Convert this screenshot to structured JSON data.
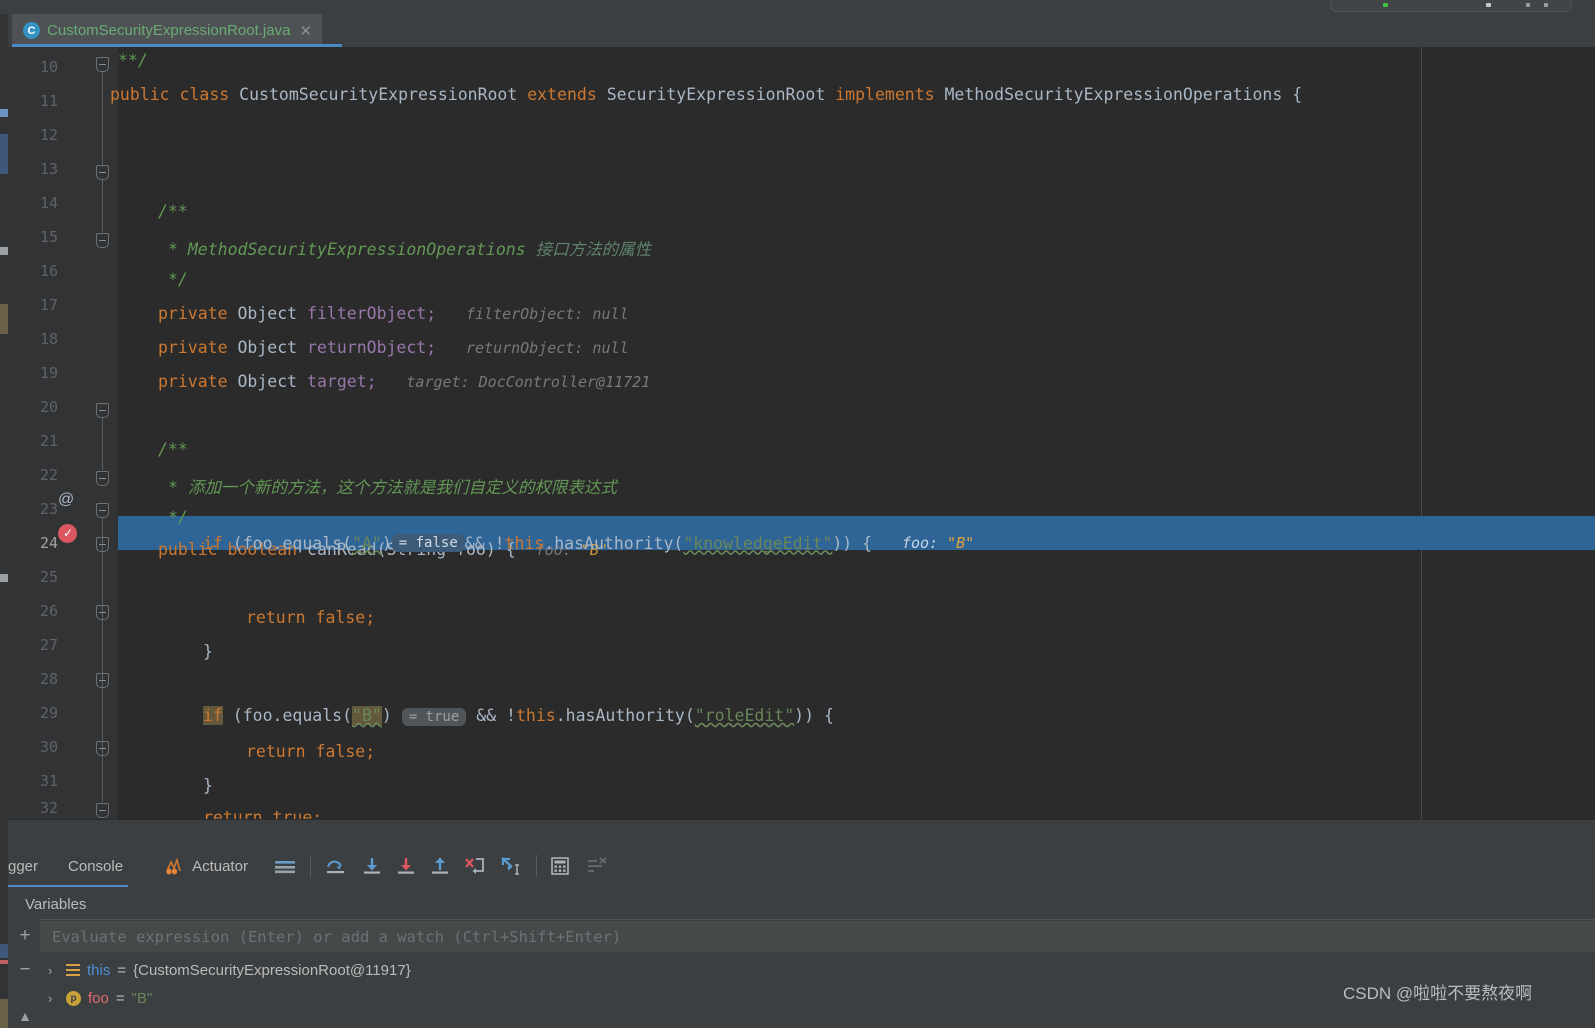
{
  "window": {
    "tab": {
      "icon": "java-class-icon",
      "label": "CustomSecurityExpressionRoot.java",
      "close": "✕"
    }
  },
  "editor": {
    "margin_guide": true,
    "lines": [
      {
        "num": "10",
        "fold": true,
        "gutter": "",
        "selected": false
      },
      {
        "num": "11",
        "fold": false,
        "gutter": "",
        "selected": false
      },
      {
        "num": "12",
        "fold": false,
        "gutter": "",
        "selected": false
      },
      {
        "num": "13",
        "fold": true,
        "gutter": "",
        "selected": false
      },
      {
        "num": "14",
        "fold": false,
        "gutter": "",
        "selected": false
      },
      {
        "num": "15",
        "fold": true,
        "gutter": "",
        "selected": false
      },
      {
        "num": "16",
        "fold": false,
        "gutter": "",
        "selected": false
      },
      {
        "num": "17",
        "fold": false,
        "gutter": "",
        "selected": false
      },
      {
        "num": "18",
        "fold": false,
        "gutter": "",
        "selected": false
      },
      {
        "num": "19",
        "fold": false,
        "gutter": "",
        "selected": false
      },
      {
        "num": "20",
        "fold": true,
        "gutter": "",
        "selected": false
      },
      {
        "num": "21",
        "fold": false,
        "gutter": "",
        "selected": false
      },
      {
        "num": "22",
        "fold": true,
        "gutter": "",
        "selected": false
      },
      {
        "num": "23",
        "fold": true,
        "gutter": "annotation",
        "selected": false
      },
      {
        "num": "24",
        "fold": true,
        "gutter": "breakpoint",
        "selected": true
      },
      {
        "num": "25",
        "fold": false,
        "gutter": "",
        "selected": false
      },
      {
        "num": "26",
        "fold": true,
        "gutter": "",
        "selected": false
      },
      {
        "num": "27",
        "fold": false,
        "gutter": "",
        "selected": false
      },
      {
        "num": "28",
        "fold": true,
        "gutter": "",
        "selected": false
      },
      {
        "num": "29",
        "fold": false,
        "gutter": "",
        "selected": false
      },
      {
        "num": "30",
        "fold": true,
        "gutter": "",
        "selected": false
      },
      {
        "num": "31",
        "fold": false,
        "gutter": "",
        "selected": false
      },
      {
        "num": "32",
        "fold": true,
        "gutter": "",
        "selected": false
      }
    ],
    "gutter_annotation_symbol": "@",
    "code": {
      "l10": "**/",
      "l11_public": "public",
      "l11_class": "class",
      "l11_name": "CustomSecurityExpressionRoot",
      "l11_extends": "extends",
      "l11_super": "SecurityExpressionRoot",
      "l11_implements": "implements",
      "l11_iface": "MethodSecurityExpressionOperations",
      "l11_brace": "{",
      "l13": "/**",
      "l14_star": "* ",
      "l14_code": "MethodSecurityExpressionOperations",
      "l14_cn": " 接口方法的属性",
      "l15": "*/",
      "l16_mod": "private",
      "l16_type": "Object",
      "l16_name": "filterObject",
      "l16_semi": ";",
      "l16_hint": "filterObject: null",
      "l17_mod": "private",
      "l17_type": "Object",
      "l17_name": "returnObject",
      "l17_semi": ";",
      "l17_hint": "returnObject: null",
      "l18_mod": "private",
      "l18_type": "Object",
      "l18_name": "target",
      "l18_semi": ";",
      "l18_hint": "target: DocController@11721",
      "l20": "/**",
      "l21_star": "* ",
      "l21_cn": "添加一个新的方法，这个方法就是我们自定义的权限表达式",
      "l22": "*/",
      "l23_public": "public",
      "l23_boolean": "boolean",
      "l23_method": "canRead",
      "l23_paren_open": "(",
      "l23_argtype": "String",
      "l23_argname": " foo",
      "l23_paren_close": ") {",
      "l23_hint_name": "foo: ",
      "l23_hint_val": "\"B\"",
      "l24_if": "if",
      "l24_expr1": " (foo.equals(",
      "l24_strA": "\"A\"",
      "l24_close1": ")",
      "l24_badge": "= false",
      "l24_and": "&& !",
      "l24_this": "this",
      "l24_dot_auth": ".hasAuthority(",
      "l24_strAuth": "\"knowledgeEdit\"",
      "l24_tail": ")) {",
      "l24_hint_name": "foo: ",
      "l24_hint_val": "\"B\"",
      "l25": "return false;",
      "l25_kw": "return",
      "l25_val": " false;",
      "l26": "}",
      "l28_if": "if",
      "l28_expr1": " (foo.equals(",
      "l28_strB": "\"B\"",
      "l28_close1": ")",
      "l28_badge": "= true",
      "l28_and": "&& !",
      "l28_this": "this",
      "l28_dot_auth": ".hasAuthority(",
      "l28_strAuth": "\"roleEdit\"",
      "l28_tail": ")) {",
      "l29_kw": "return",
      "l29_val": " false;",
      "l30": "}",
      "l31_kw": "return",
      "l31_val": " true;",
      "l32": "}"
    }
  },
  "debugger": {
    "tabs": [
      {
        "name": "debugger-tab",
        "label": "gger",
        "icon": ""
      },
      {
        "name": "console-tab",
        "label": "Console",
        "icon": ""
      },
      {
        "name": "actuator-tab",
        "label": "Actuator",
        "icon": "actuator-icon"
      }
    ],
    "toolbar_icons": [
      "menu-icon",
      "step-over-icon",
      "step-into-icon",
      "force-step-into-icon",
      "step-out-icon",
      "drop-frame-icon",
      "run-to-cursor-icon",
      "evaluate-expression-icon",
      "filter-icon"
    ],
    "variables_tab_label": "Variables",
    "rail_buttons": [
      "add-watch-button",
      "remove-watch-button",
      "collapse-button"
    ],
    "rail_labels": {
      "add": "+",
      "remove": "−",
      "collapse": "▲"
    },
    "evaluate_placeholder": "Evaluate expression (Enter) or add a watch (Ctrl+Shift+Enter)",
    "variables": [
      {
        "arrow": "›",
        "icon": "object-field-icon",
        "name": "this",
        "eq": " = ",
        "value": "{CustomSecurityExpressionRoot@11917}",
        "value_type": "object"
      },
      {
        "arrow": "›",
        "icon": "primitive-param-icon",
        "icon_letter": "p",
        "name": "foo",
        "eq": " = ",
        "value": "\"B\"",
        "value_type": "string"
      }
    ]
  },
  "watermark": "CSDN @啦啦不要熬夜啊",
  "colors": {
    "editor_bg": "#2b2b2b",
    "panel_bg": "#3c3f41",
    "gutter_bg": "#313335",
    "selection": "#2f6496",
    "tab_accent": "#4a88c7",
    "keyword": "#cc7832",
    "string": "#6a8759",
    "field": "#9876aa",
    "comment": "#629755",
    "breakpoint": "#db5860"
  }
}
